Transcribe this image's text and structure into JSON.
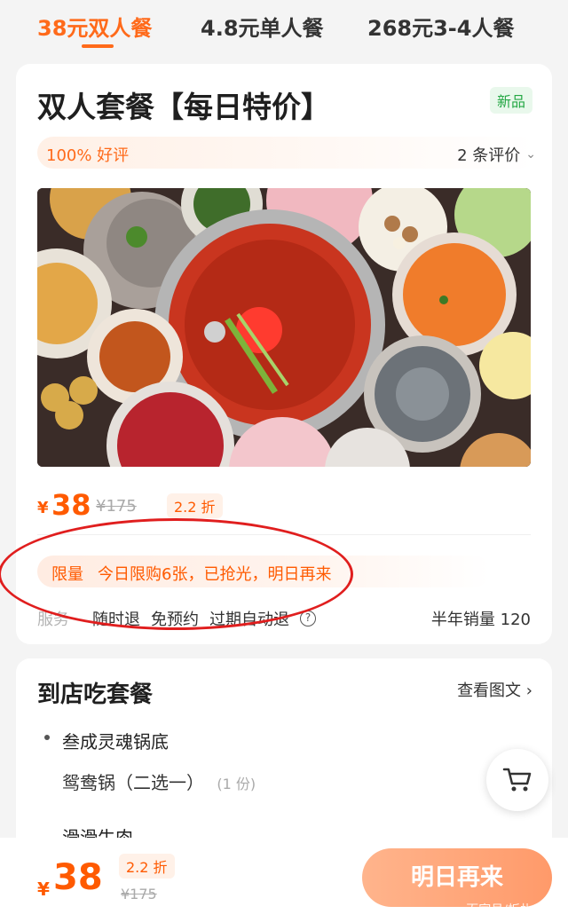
{
  "tabs": [
    {
      "label": "38元双人餐",
      "active": true
    },
    {
      "label": "4.8元单人餐",
      "active": false
    },
    {
      "label": "268元3-4人餐",
      "active": false
    }
  ],
  "product": {
    "title": "双人套餐【每日特价】",
    "badge": "新品",
    "rating_text": "100% 好评",
    "reviews_text": "2 条评价",
    "currency": "¥",
    "price": "38",
    "original_price": "¥175",
    "discount": "2.2 折",
    "limit_tag": "限量",
    "limit_text": "今日限购6张，已抢光，明日再来",
    "service_label": "服务",
    "services": [
      "随时退",
      "免预约",
      "过期自动退"
    ],
    "sales_text": "半年销量 120"
  },
  "package": {
    "title": "到店吃套餐",
    "view_detail": "查看图文",
    "item_name": "叁成灵魂锅底",
    "sub_item": "鸳鸯锅（二选一）",
    "sub_qty": "(1 份)",
    "next_item_partial": "滑滑牛肉"
  },
  "bottom": {
    "currency": "¥",
    "price": "38",
    "discount": "2.2 折",
    "original_price": "¥175",
    "cta": "明日再来",
    "watermark": "百家号/板扎云南"
  },
  "colors": {
    "accent": "#ff6a1a",
    "price": "#ff5a00",
    "new_badge": "#24a744",
    "annotation": "#e01e1e"
  }
}
